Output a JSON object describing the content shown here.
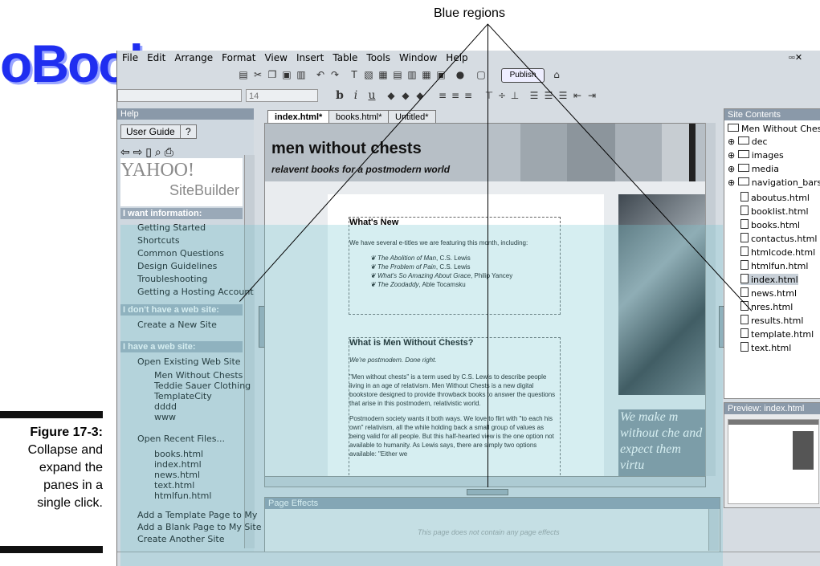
{
  "brand": {
    "logo_text": "oBooks",
    "accent": "#1f2ef0"
  },
  "callout": {
    "label": "Blue regions"
  },
  "figure": {
    "number": "Figure 17-3:",
    "caption_lines": [
      "Collapse and",
      "expand the",
      "panes in a",
      "single click."
    ]
  },
  "menubar": {
    "items": [
      "File",
      "Edit",
      "Arrange",
      "Format",
      "View",
      "Insert",
      "Table",
      "Tools",
      "Window",
      "Help"
    ]
  },
  "toolbar": {
    "publish_label": "Publish"
  },
  "formatbar": {
    "font_size": "14",
    "bold": "b",
    "italic": "i",
    "underline": "u"
  },
  "help_pane": {
    "title": "Help",
    "tabs": [
      "User Guide",
      "?"
    ],
    "brand_top": "YAHOO!",
    "brand_bottom": "SiteBuilder",
    "sections": [
      {
        "heading": "I want information:",
        "items": [
          "Getting Started",
          "Shortcuts",
          "Common Questions",
          "Design Guidelines",
          "Troubleshooting",
          "Getting a Hosting Account"
        ]
      },
      {
        "heading": "I don't have a web site:",
        "items": [
          "Create a New Site"
        ]
      },
      {
        "heading": "I have a web site:",
        "items": [
          "Open Existing Web Site"
        ]
      }
    ],
    "existing_sites": [
      "Men Without Chests",
      "Teddie Sauer Clothing",
      "TemplateCity",
      "dddd",
      "www"
    ],
    "open_recent_label": "Open Recent Files...",
    "recent_files": [
      "books.html",
      "index.html",
      "news.html",
      "text.html",
      "htmlfun.html"
    ],
    "bottom_items": [
      "Add a Template Page to My",
      "Add a Blank Page to My Site",
      "Create Another Site"
    ]
  },
  "doc_tabs": [
    "index.html*",
    "books.html*",
    "Untitled*"
  ],
  "page": {
    "site_title": "men without chests",
    "site_subtitle": "relavent books for a postmodern world",
    "whats_new_heading": "What's New",
    "whats_new_intro": "We have several e-titles we are featuring this month, including:",
    "books": [
      {
        "title": "The Abolition of Man",
        "author": ", C.S. Lewis"
      },
      {
        "title": "The Problem of Pain",
        "author": ", C.S. Lewis"
      },
      {
        "title": "What's So Amazing About Grace",
        "author": ", Philip Yancey"
      },
      {
        "title": "The Zoodaddy",
        "author": ", Able Tocamsku"
      }
    ],
    "what_is_heading": "What is Men Without Chests?",
    "what_is_tagline": "We're postmodern. Done right.",
    "para1": "\"Men without chests\" is a term used by C.S. Lewis to describe people living in an age of relativism. Men Without Chests is a new digital bookstore designed to provide throwback books to answer the questions that arise in this postmodern, relativistic world.",
    "para2": "Postmodern society wants it both ways. We love to flirt with \"to each his own\" relativism, all the while holding back a small group of values as being valid for all people. But this half-hearted view is the one option not available to humanity. As Lewis says, there are simply two options available: \"Either we",
    "quote": "We make m without che and expect them virtu"
  },
  "effects_pane": {
    "title": "Page Effects",
    "message": "This page does not contain any page effects"
  },
  "site_pane": {
    "title": "Site Contents",
    "root": "Men Without Chests",
    "folders": [
      "dec",
      "images",
      "media",
      "navigation_bars"
    ],
    "files": [
      "aboutus.html",
      "booklist.html",
      "books.html",
      "contactus.html",
      "htmlcode.html",
      "htmlfun.html",
      "index.html",
      "news.html",
      "nres.html",
      "results.html",
      "template.html",
      "text.html"
    ],
    "selected_file": "index.html"
  },
  "preview_pane": {
    "title": "Preview: index.html"
  }
}
